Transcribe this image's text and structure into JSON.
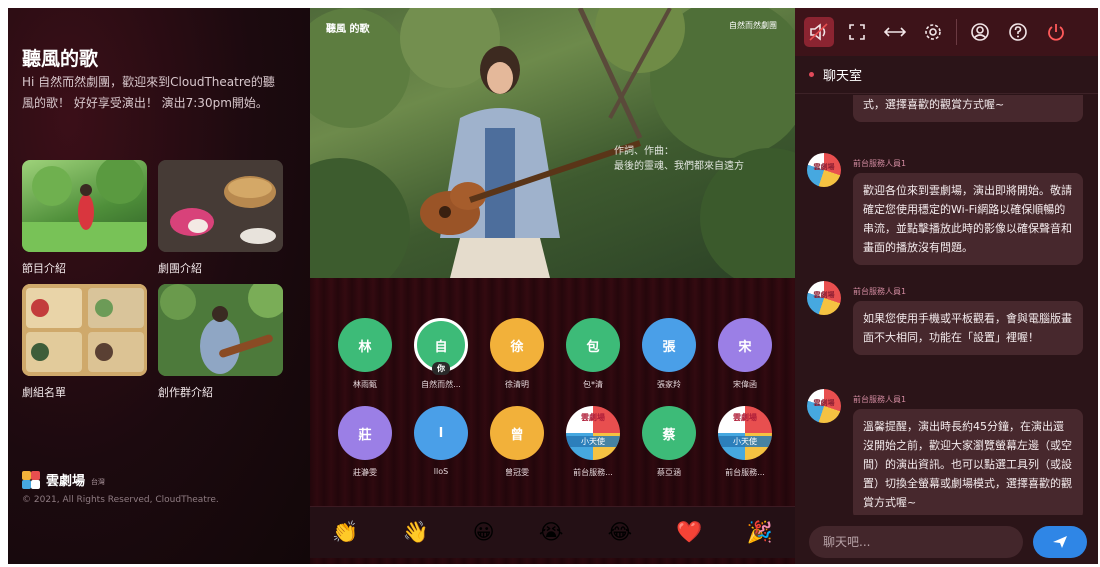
{
  "show": {
    "title": "聽風的歌",
    "description": "Hi 自然而然劇團，歡迎來到CloudTheatre的聽風的歌！ 好好享受演出！ 演出7:30pm開始。"
  },
  "sections": [
    {
      "label": "節目介紹"
    },
    {
      "label": "劇團介紹"
    },
    {
      "label": "劇組名單"
    },
    {
      "label": "創作群介紹"
    }
  ],
  "brand": {
    "name": "雲劇場",
    "sub": "台灣",
    "copyright": "© 2021, All Rights Reserved, CloudTheatre."
  },
  "video": {
    "title": "聽風 的歌",
    "credit": "自然而然劇團",
    "subtitle_line1": "作詞、作曲：",
    "subtitle_line2": "最後的靈魂、我們都來自遠方"
  },
  "audience": [
    {
      "initial": "林",
      "name": "林雨甄",
      "color": "#3dbb78"
    },
    {
      "initial": "自",
      "name": "自然而然...",
      "color": "#3dbb78",
      "you": "你"
    },
    {
      "initial": "徐",
      "name": "徐清明",
      "color": "#f2b13a"
    },
    {
      "initial": "包",
      "name": "包*清",
      "color": "#3dbb78"
    },
    {
      "initial": "張",
      "name": "張家羚",
      "color": "#4a9fe8"
    },
    {
      "initial": "宋",
      "name": "宋偉函",
      "color": "#9b7fe6"
    },
    {
      "initial": "莊",
      "name": "莊瀞雯",
      "color": "#9b7fe6"
    },
    {
      "initial": "l",
      "name": "lloS",
      "color": "#4a9fe8"
    },
    {
      "initial": "曾",
      "name": "曾冠雯",
      "color": "#f2b13a"
    },
    {
      "mascot": true,
      "top": "雲劇場",
      "bottom": "小天使",
      "name": "前台服務..."
    },
    {
      "initial": "蔡",
      "name": "蔡亞涵",
      "color": "#3dbb78"
    },
    {
      "mascot": true,
      "top": "雲劇場",
      "bottom": "小天使",
      "name": "前台服務..."
    }
  ],
  "emojis": [
    "👏",
    "👋",
    "😀",
    "😭",
    "😂",
    "❤️",
    "🎉"
  ],
  "toolbar": {
    "icons": [
      "speaker-icon",
      "fullscreen-icon",
      "swap-icon",
      "gear-icon",
      "user-icon",
      "help-icon",
      "power-icon"
    ]
  },
  "chat": {
    "room_label": "聊天室",
    "messages": [
      {
        "sender": "",
        "text": "式，選擇喜歡的觀賞方式喔~"
      },
      {
        "sender": "前台服務人員1",
        "text": "歡迎各位來到雲劇場，演出即將開始。敬請確定您使用穩定的Wi-Fi網路以確保順暢的串流，並點擊播放此時的影像以確保聲音和畫面的播放沒有問題。"
      },
      {
        "sender": "前台服務人員1",
        "text": "如果您使用手機或平板觀看，會與電腦版畫面不大相同，功能在「設置」裡喔！"
      },
      {
        "sender": "前台服務人員1",
        "text": "溫馨提醒，演出時長約45分鐘，在演出還沒開始之前，歡迎大家瀏覽螢幕左邊（或空間）的演出資訊。也可以點選工具列（或設置）切換全螢幕或劇場模式，選擇喜歡的觀賞方式喔~"
      }
    ],
    "avatar_text": "雲劇場",
    "input_placeholder": "聊天吧..."
  }
}
